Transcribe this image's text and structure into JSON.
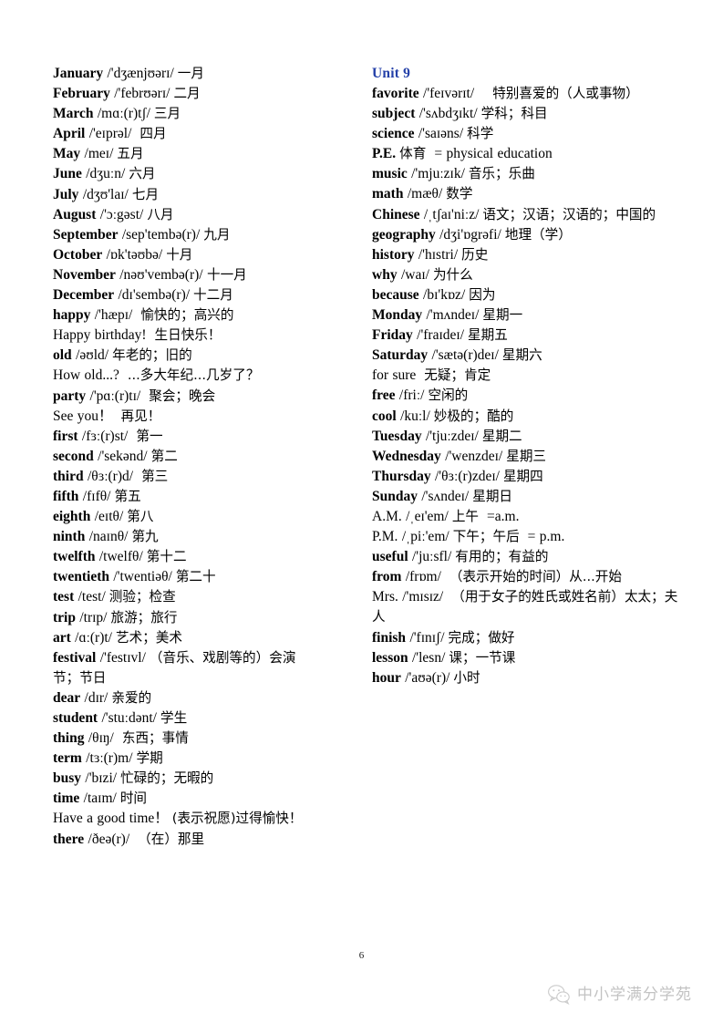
{
  "document": {
    "page_number": "6",
    "accent_color": "#2440a8",
    "watermark": {
      "icon": "wechat-icon",
      "text": "中小学满分学苑"
    }
  },
  "left_column": {
    "entries": [
      {
        "word": "January",
        "bold": true,
        "phonetic": "/'dʒænjʊərɪ/",
        "gap": "sm",
        "meaning": "一月"
      },
      {
        "word": "February",
        "bold": true,
        "phonetic": "/'febrʊərɪ/",
        "gap": "sm",
        "meaning": "二月"
      },
      {
        "word": "March",
        "bold": true,
        "phonetic": "/mɑː(r)tʃ/",
        "gap": "sm",
        "meaning": "三月"
      },
      {
        "word": "April",
        "bold": true,
        "phonetic": "/'eɪprəl/",
        "gap": "md",
        "meaning": "四月"
      },
      {
        "word": "May",
        "bold": true,
        "phonetic": "/meɪ/",
        "gap": "sm",
        "meaning": "五月"
      },
      {
        "word": "June",
        "bold": true,
        "phonetic": "/dʒuːn/",
        "gap": "sm",
        "meaning": "六月"
      },
      {
        "word": "July",
        "bold": true,
        "phonetic": "/dʒʊ'laɪ/",
        "gap": "sm",
        "meaning": "七月"
      },
      {
        "word": "August",
        "bold": true,
        "phonetic": "/'ɔːgəst/",
        "gap": "sm",
        "meaning": "八月"
      },
      {
        "word": "September",
        "bold": true,
        "phonetic": "/sep'tembə(r)/",
        "gap": "sm",
        "meaning": "九月"
      },
      {
        "word": "October",
        "bold": true,
        "phonetic": "/ɒk'təʊbə/",
        "gap": "sm",
        "meaning": "十月"
      },
      {
        "word": "November",
        "bold": true,
        "phonetic": "/nəʊ'vembə(r)/",
        "gap": "none",
        "meaning": "十一月"
      },
      {
        "word": "December",
        "bold": true,
        "phonetic": "/dɪ'sembə(r)/",
        "gap": "sm",
        "meaning": "十二月"
      },
      {
        "word": "happy",
        "bold": true,
        "phonetic": "/'hæpɪ/",
        "gap": "md",
        "meaning": "愉快的；高兴的"
      },
      {
        "word": "Happy birthday!",
        "bold": false,
        "phonetic": "",
        "gap": "md",
        "meaning": "生日快乐！"
      },
      {
        "word": "old",
        "bold": true,
        "phonetic": "/əʊld/",
        "gap": "sm",
        "meaning": "年老的；旧的"
      },
      {
        "word": "How old...?",
        "bold": false,
        "phonetic": "",
        "gap": "md",
        "meaning": "...多大年纪...几岁了？"
      },
      {
        "word": "party",
        "bold": true,
        "phonetic": "/'pɑː(r)tɪ/",
        "gap": "md",
        "meaning": "聚会；晚会",
        "pre_gap": "md"
      },
      {
        "word": "See you！",
        "bold": false,
        "phonetic": "",
        "gap": "md",
        "meaning": "再见！"
      },
      {
        "word": "first",
        "bold": true,
        "phonetic": "/fɜː(r)st/",
        "gap": "md",
        "meaning": "第一"
      },
      {
        "word": "second",
        "bold": true,
        "phonetic": "/'sekənd/",
        "gap": "sm",
        "meaning": "第二"
      },
      {
        "word": "third",
        "bold": true,
        "phonetic": "/θɜː(r)d/",
        "gap": "md",
        "meaning": "第三"
      },
      {
        "word": "fifth",
        "bold": true,
        "phonetic": "/fɪfθ/",
        "gap": "sm",
        "meaning": "第五"
      },
      {
        "word": "eighth",
        "bold": true,
        "phonetic": "/eɪtθ/",
        "gap": "sm",
        "meaning": "第八"
      },
      {
        "word": "ninth",
        "bold": true,
        "phonetic": "/naɪnθ/",
        "gap": "sm",
        "meaning": "第九"
      },
      {
        "word": "twelfth",
        "bold": true,
        "phonetic": "/twelfθ/",
        "gap": "sm",
        "meaning": "第十二"
      },
      {
        "word": "twentieth",
        "bold": true,
        "phonetic": "/'twentiəθ/",
        "gap": "sm",
        "meaning": "第二十"
      },
      {
        "word": "test",
        "bold": true,
        "phonetic": "/test/",
        "gap": "sm",
        "meaning": "测验；检查"
      },
      {
        "word": "trip",
        "bold": true,
        "phonetic": "/trɪp/",
        "gap": "sm",
        "meaning": "旅游；旅行"
      },
      {
        "word": "art",
        "bold": true,
        "phonetic": "/ɑː(r)t/",
        "gap": "sm",
        "meaning": "艺术；美术"
      },
      {
        "word": "festival",
        "bold": true,
        "phonetic": "/'festɪvl/",
        "gap": "sm",
        "meaning": "（音乐、戏剧等的）会演节；节日"
      },
      {
        "word": "dear",
        "bold": true,
        "phonetic": "/dɪr/",
        "gap": "sm",
        "meaning": "亲爱的"
      },
      {
        "word": "student",
        "bold": true,
        "phonetic": "/'stuːdənt/",
        "gap": "sm",
        "meaning": "学生"
      },
      {
        "word": "thing",
        "bold": true,
        "phonetic": "/θɪŋ/",
        "gap": "md",
        "meaning": "东西；事情"
      },
      {
        "word": "term",
        "bold": true,
        "phonetic": "/tɜː(r)m/",
        "gap": "sm",
        "meaning": "学期"
      },
      {
        "word": "busy",
        "bold": true,
        "phonetic": "/'bɪzi/",
        "gap": "sm",
        "meaning": "忙碌的；无暇的"
      },
      {
        "word": "time",
        "bold": true,
        "phonetic": "/taɪm/",
        "gap": "sm",
        "meaning": "时间"
      },
      {
        "word": "Have a good time！",
        "bold": false,
        "phonetic": "",
        "gap": "sm",
        "meaning": "(表示祝愿)过得愉快！"
      },
      {
        "word": "there",
        "bold": true,
        "phonetic": "/ðeə(r)/",
        "gap": "md",
        "meaning": "（在）那里"
      }
    ]
  },
  "right_column": {
    "heading": "Unit 9",
    "entries": [
      {
        "word": "favorite",
        "bold": true,
        "phonetic": "/'feɪvərɪt/",
        "gap": "lg",
        "meaning": "特别喜爱的（人或事物）"
      },
      {
        "word": "subject",
        "bold": true,
        "phonetic": "/'sʌbdʒɪkt/",
        "gap": "sm",
        "meaning": "学科；科目"
      },
      {
        "word": "science",
        "bold": true,
        "phonetic": "/'saɪəns/",
        "gap": "sm",
        "meaning": "科学"
      },
      {
        "word": "P.E.",
        "bold": true,
        "phonetic": "",
        "gap": "sm",
        "meaning": "体育",
        "extra": "= physical education"
      },
      {
        "word": "music",
        "bold": true,
        "phonetic": "/'mjuːzɪk/",
        "gap": "sm",
        "meaning": "音乐；乐曲"
      },
      {
        "word": "math",
        "bold": true,
        "phonetic": "/mæθ/",
        "gap": "sm",
        "meaning": "数学"
      },
      {
        "word": "Chinese",
        "bold": true,
        "phonetic": "/ˌtʃaɪ'niːz/",
        "gap": "sm",
        "meaning": "语文；汉语；汉语的；中国的"
      },
      {
        "word": "geography",
        "bold": true,
        "phonetic": "/dʒi'ɒgrəfi/",
        "gap": "sm",
        "meaning": "地理（学）"
      },
      {
        "word": "history",
        "bold": true,
        "phonetic": "/'hɪstri/",
        "gap": "sm",
        "meaning": "历史"
      },
      {
        "word": "why",
        "bold": true,
        "phonetic": "/waɪ/",
        "gap": "sm",
        "meaning": "为什么"
      },
      {
        "word": "because",
        "bold": true,
        "phonetic": "/bɪ'kɒz/",
        "gap": "sm",
        "meaning": "因为"
      },
      {
        "word": "Monday",
        "bold": true,
        "phonetic": "/'mʌndeɪ/",
        "gap": "sm",
        "meaning": "星期一"
      },
      {
        "word": "Friday",
        "bold": true,
        "phonetic": "/'fraɪdeɪ/",
        "gap": "sm",
        "meaning": "星期五"
      },
      {
        "word": "Saturday",
        "bold": true,
        "phonetic": "/'sætə(r)deɪ/",
        "gap": "sm",
        "meaning": "星期六"
      },
      {
        "word": "for sure",
        "bold": false,
        "phonetic": "",
        "gap": "md",
        "meaning": "无疑；肯定"
      },
      {
        "word": "free",
        "bold": true,
        "phonetic": "/friː/",
        "gap": "sm",
        "meaning": "空闲的"
      },
      {
        "word": "cool",
        "bold": true,
        "phonetic": "/kuːl/",
        "gap": "sm",
        "meaning": "妙极的；酷的"
      },
      {
        "word": "Tuesday",
        "bold": true,
        "phonetic": "/'tjuːzdeɪ/",
        "gap": "sm",
        "meaning": "星期二"
      },
      {
        "word": "Wednesday",
        "bold": true,
        "phonetic": "/'wenzdeɪ/",
        "gap": "sm",
        "meaning": "星期三"
      },
      {
        "word": "Thursday",
        "bold": true,
        "phonetic": "/'θɜː(r)zdeɪ/",
        "gap": "sm",
        "meaning": "星期四"
      },
      {
        "word": "Sunday",
        "bold": true,
        "phonetic": "/'sʌndeɪ/",
        "gap": "sm",
        "meaning": "星期日"
      },
      {
        "word": "A.M.",
        "bold": false,
        "phonetic": "/ˌeɪ'em/",
        "gap": "sm",
        "meaning": "上午",
        "extra": "=a.m."
      },
      {
        "word": "P.M.",
        "bold": false,
        "phonetic": "/ˌpiː'em/",
        "gap": "sm",
        "meaning": "下午；午后",
        "extra": "= p.m."
      },
      {
        "word": "useful",
        "bold": true,
        "phonetic": "/'juːsfl/",
        "gap": "sm",
        "meaning": "有用的；有益的"
      },
      {
        "word": "from",
        "bold": true,
        "phonetic": "/frɒm/",
        "gap": "md",
        "meaning": "（表示开始的时间）从...开始"
      },
      {
        "word": "Mrs.",
        "bold": false,
        "phonetic": "/'mɪsɪz/",
        "gap": "md",
        "meaning": "（用于女子的姓氏或姓名前）太太；夫人"
      },
      {
        "word": "finish",
        "bold": true,
        "phonetic": "/'fɪnɪʃ/",
        "gap": "sm",
        "meaning": "完成；做好"
      },
      {
        "word": "lesson",
        "bold": true,
        "phonetic": "/'lesn/",
        "gap": "sm",
        "meaning": "课；一节课"
      },
      {
        "word": "hour",
        "bold": true,
        "phonetic": "/'aʊə(r)/",
        "gap": "sm",
        "meaning": "小时"
      }
    ]
  }
}
